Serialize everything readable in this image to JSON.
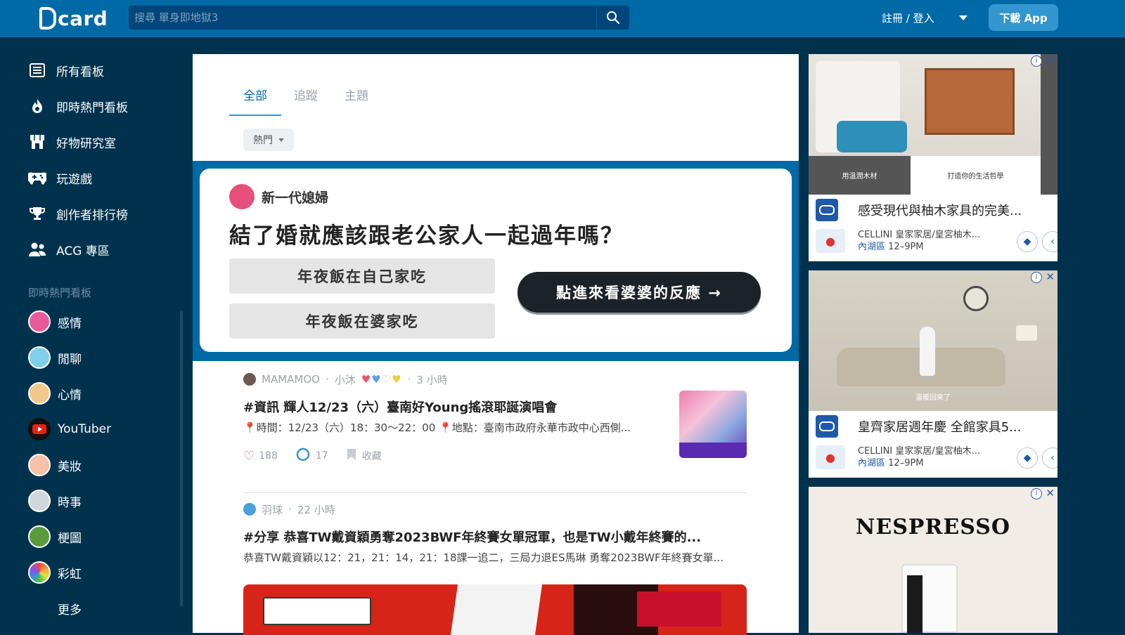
{
  "header": {
    "logo_text": "card",
    "search_placeholder": "搜尋 單身即地獄3",
    "signin_label": "註冊 / 登入",
    "download_label": "下載 App"
  },
  "sidebar": {
    "items": [
      {
        "label": "所有看板",
        "icon": "list-icon"
      },
      {
        "label": "即時熱門看板",
        "icon": "fire-icon"
      },
      {
        "label": "好物研究室",
        "icon": "store-icon"
      },
      {
        "label": "玩遊戲",
        "icon": "gamepad-icon"
      },
      {
        "label": "創作者排行榜",
        "icon": "trophy-icon"
      },
      {
        "label": "ACG 專區",
        "icon": "users-icon"
      }
    ],
    "section_title": "即時熱門看板",
    "boards": [
      {
        "label": "感情",
        "color": "#e85a9a"
      },
      {
        "label": "閒聊",
        "color": "#7fd0e8"
      },
      {
        "label": "心情",
        "color": "#f0c98a"
      },
      {
        "label": "YouTuber",
        "color": "#e62117"
      },
      {
        "label": "美妝",
        "color": "#f6c1a8"
      },
      {
        "label": "時事",
        "color": "#cfd6dc"
      },
      {
        "label": "梗圖",
        "color": "#5a9a3a"
      },
      {
        "label": "彩虹",
        "color": "#e8a43a"
      }
    ],
    "more_label": "更多"
  },
  "main": {
    "tabs": [
      "全部",
      "追蹤",
      "主題"
    ],
    "sort_label": "熱門",
    "promo": {
      "user": "新一代媳婦",
      "title": "結了婚就應該跟老公家人一起過年嗎？",
      "option1": "年夜飯在自己家吃",
      "option2": "年夜飯在婆家吃",
      "cta": "點進來看婆婆的反應 →"
    },
    "posts": [
      {
        "board": "MAMAMOO",
        "author": "小沐",
        "time": "3 小時",
        "title": "#資訊 輝人12/23（六）臺南好Young搖滾耶誕演唱會",
        "excerpt": "📍時間：12/23（六）18：30～22：00 📍地點：臺南市政府永華市政中心西側...",
        "likes": "188",
        "comments": "17",
        "save_label": "收藏"
      },
      {
        "board": "羽球",
        "time": "22 小時",
        "title": "#分享 恭喜TW戴資穎勇奪2023BWF年終賽女單冠軍，也是TW小戴年終賽的...",
        "excerpt": "恭喜TW戴資穎以12：21，21：14，21：18課一追二，三局力退ES馬琳 勇奪2023BWF年終賽女單..."
      }
    ]
  },
  "ads": [
    {
      "headline": "感受現代與柚木家具的完美...",
      "advertiser": "CELLINI 皇家家居/皇宮柚木...",
      "location": "內湖區",
      "hours": "12–9PM",
      "caption_left": "用溫潤木材",
      "caption_right": "打造你的生活哲學"
    },
    {
      "headline": "皇齊家居週年慶 全館家具5...",
      "advertiser": "CELLINI 皇家家居/皇宮柚木...",
      "location": "內湖區",
      "hours": "12–9PM",
      "caption": "溫暖回來了"
    },
    {
      "brand": "NESPRESSO"
    }
  ],
  "colors": {
    "header": "#006aa6",
    "sidebar": "#00324e",
    "accent": "#3397cf"
  }
}
